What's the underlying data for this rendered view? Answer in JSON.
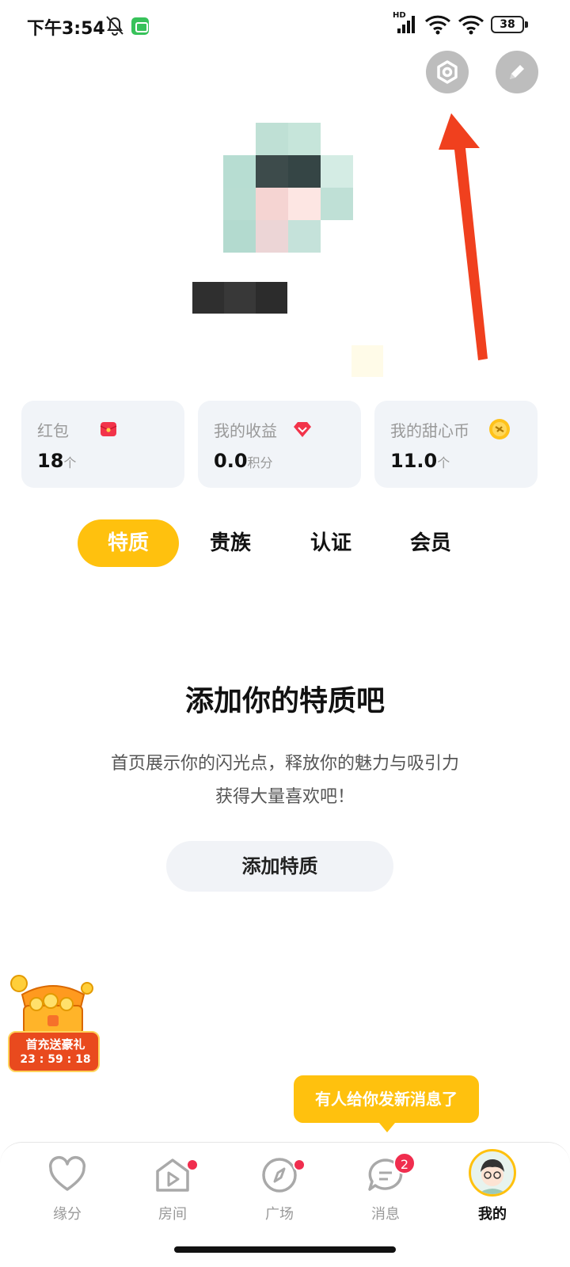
{
  "status_bar": {
    "time": "下午3:54",
    "hd": "HD",
    "battery": "38"
  },
  "header": {
    "settings_icon": "gear-icon",
    "edit_icon": "pencil-icon"
  },
  "stats": [
    {
      "label": "红包",
      "value": "18",
      "unit": "个",
      "icon": "red-envelope-icon"
    },
    {
      "label": "我的收益",
      "value": "0.0",
      "unit": "积分",
      "icon": "diamond-icon"
    },
    {
      "label": "我的甜心币",
      "value": "11.0",
      "unit": "个",
      "icon": "coin-icon"
    }
  ],
  "tabs": [
    "特质",
    "贵族",
    "认证",
    "会员"
  ],
  "empty_state": {
    "title": "添加你的特质吧",
    "desc_line1": "首页展示你的闪光点，释放你的魅力与吸引力",
    "desc_line2": "获得大量喜欢吧！",
    "button": "添加特质"
  },
  "promo": {
    "title": "首充送豪礼",
    "timer": "23 : 59 : 18"
  },
  "tooltip": "有人给你发新消息了",
  "bottom_nav": [
    {
      "label": "缘分",
      "icon": "heart-icon"
    },
    {
      "label": "房间",
      "icon": "play-room-icon",
      "dot": true
    },
    {
      "label": "广场",
      "icon": "compass-icon",
      "dot": true
    },
    {
      "label": "消息",
      "icon": "message-icon",
      "badge": "2"
    },
    {
      "label": "我的",
      "icon": "profile-avatar"
    }
  ],
  "colors": {
    "accent": "#ffc10e",
    "badge": "#f02d4e",
    "card_bg": "#f1f4f8",
    "annotation": "#f0401e"
  }
}
